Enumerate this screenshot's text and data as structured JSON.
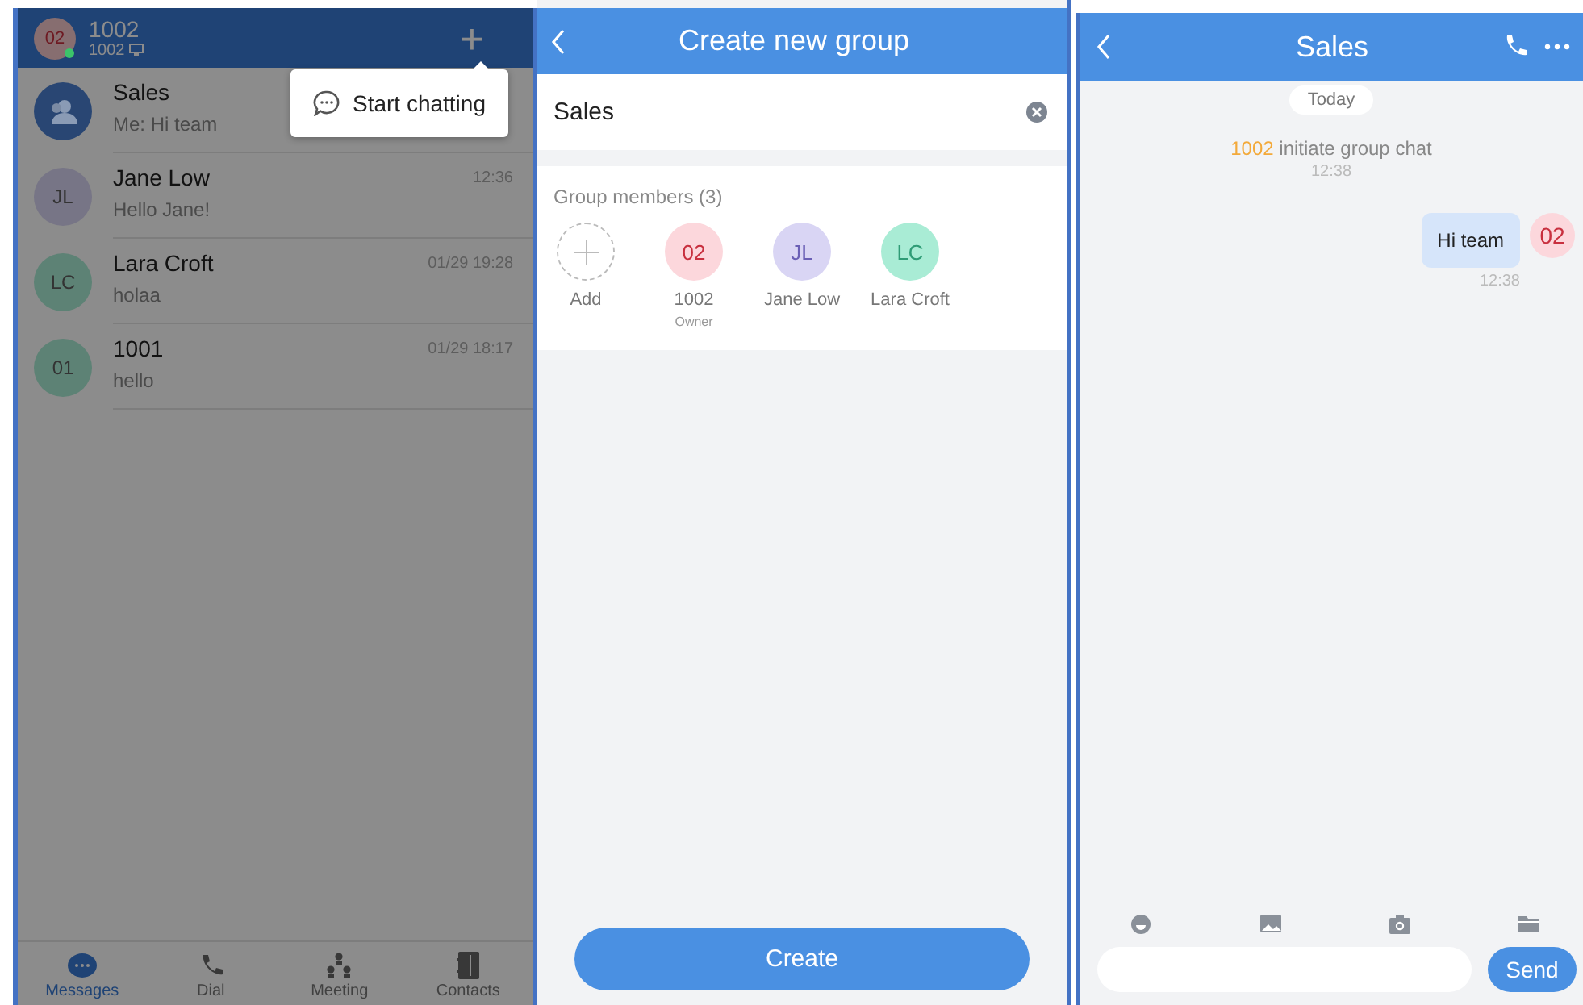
{
  "messages_screen": {
    "dimmed": true,
    "header": {
      "avatar": "02",
      "color": "#876e70",
      "online": true,
      "name": "1002",
      "account": "1002",
      "add_button": "+"
    },
    "popup": {
      "label": "Start chatting"
    },
    "conversations": [
      {
        "kind": "group",
        "name": "Sales",
        "preview": "Me: Hi team",
        "color": "#294673"
      },
      {
        "kind": "contact",
        "avatar": "JL",
        "name": "Jane Low",
        "preview": "Hello Jane!",
        "time": "12:36",
        "color": "#777586"
      },
      {
        "kind": "contact",
        "avatar": "LC",
        "name": "Lara Croft",
        "preview": "holaa",
        "time": "01/29 19:28",
        "color": "#5d8275"
      },
      {
        "kind": "contact",
        "avatar": "01",
        "name": "1001",
        "preview": "hello",
        "time": "01/29 18:17",
        "color": "#5d8275"
      }
    ],
    "tabs": [
      {
        "kind": "messages",
        "label": "Messages",
        "selected": true
      },
      {
        "kind": "dial",
        "label": "Dial",
        "selected": false
      },
      {
        "kind": "meeting",
        "label": "Meeting",
        "selected": false
      },
      {
        "kind": "contacts",
        "label": "Contacts",
        "selected": false
      }
    ]
  },
  "create_group_screen": {
    "title": "Create new group",
    "group_name": "Sales",
    "members_label": "Group members (3)",
    "members": [
      {
        "kind": "add",
        "label": "Add"
      },
      {
        "kind": "member",
        "initials": "02",
        "name": "1002",
        "role": "Owner",
        "color": "#fcd7dc"
      },
      {
        "kind": "member",
        "initials": "JL",
        "name": "Jane Low",
        "color": "#d9d5f4"
      },
      {
        "kind": "member",
        "initials": "LC",
        "name": "Lara Croft",
        "color": "#a9ecd5"
      }
    ],
    "create_button": "Create"
  },
  "chat_screen": {
    "title": "Sales",
    "date_chip": "Today",
    "system_message": {
      "actor": "1002",
      "text": "initiate group chat",
      "time": "12:38"
    },
    "messages": [
      {
        "text": "Hi team",
        "time": "12:38",
        "avatar": "02",
        "color": "#fcd7dc"
      }
    ],
    "send_button": "Send"
  }
}
